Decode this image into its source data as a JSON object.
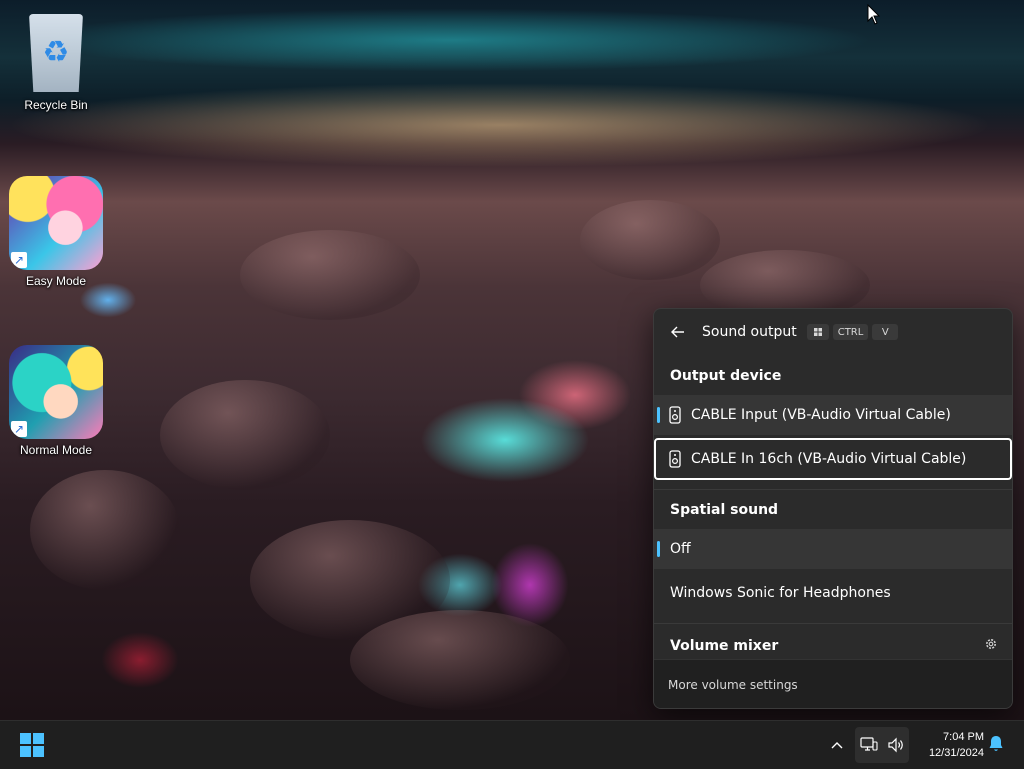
{
  "desktop": {
    "icons": [
      {
        "label": "Recycle Bin"
      },
      {
        "label": "Easy Mode"
      },
      {
        "label": "Normal Mode"
      }
    ]
  },
  "flyout": {
    "title": "Sound output",
    "shortcut": [
      "CTRL",
      "V"
    ],
    "output_device": {
      "label": "Output device",
      "devices": [
        {
          "name": "CABLE Input (VB-Audio Virtual Cable)",
          "selected": true
        },
        {
          "name": "CABLE In 16ch (VB-Audio Virtual Cable)",
          "focused": true
        }
      ]
    },
    "spatial_sound": {
      "label": "Spatial sound",
      "options": [
        {
          "name": "Off",
          "selected": true
        },
        {
          "name": "Windows Sonic for Headphones"
        }
      ]
    },
    "volume_mixer": {
      "label": "Volume mixer"
    },
    "footer_link": "More volume settings"
  },
  "taskbar": {
    "time": "7:04 PM",
    "date": "12/31/2024"
  },
  "colors": {
    "accent": "#4cc2ff",
    "flyout_bg": "#2b2b2b",
    "taskbar_bg": "#1f1f1f"
  }
}
